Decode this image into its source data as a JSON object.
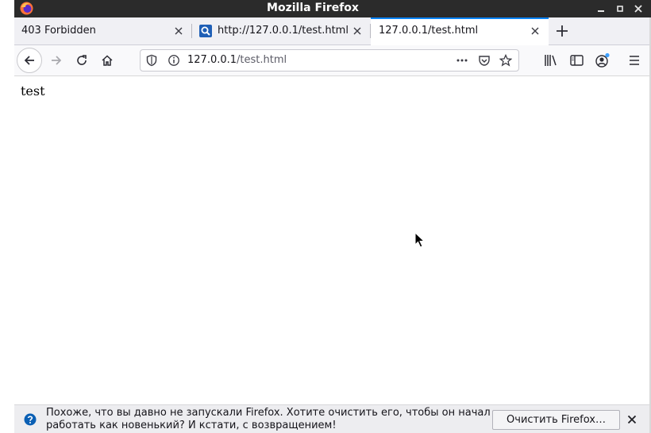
{
  "window": {
    "title": "Mozilla Firefox"
  },
  "tabs": [
    {
      "label": "403 Forbidden",
      "active": false
    },
    {
      "label": "http://127.0.0.1/test.html",
      "active": false
    },
    {
      "label": "127.0.0.1/test.html",
      "active": true
    }
  ],
  "urlbar": {
    "host": "127.0.0.1",
    "path": "/test.html"
  },
  "page": {
    "text": "test"
  },
  "notification": {
    "message": "Похоже, что вы давно не запускали Firefox. Хотите очистить его, чтобы он начал работать как новенький? И кстати, с возвращением!",
    "button": "Очистить Firefox…"
  },
  "colors": {
    "titlebar": "#2b2b2b",
    "accent": "#0a84ff",
    "tabstrip": "#f0f0f4"
  },
  "icons": [
    "firefox-logo",
    "minimize",
    "maximize",
    "close",
    "search",
    "back",
    "forward",
    "reload",
    "home",
    "tracking-shield",
    "info",
    "page-actions",
    "pocket",
    "bookmark-star",
    "library",
    "sidebar",
    "account",
    "menu",
    "question",
    "pointer"
  ]
}
